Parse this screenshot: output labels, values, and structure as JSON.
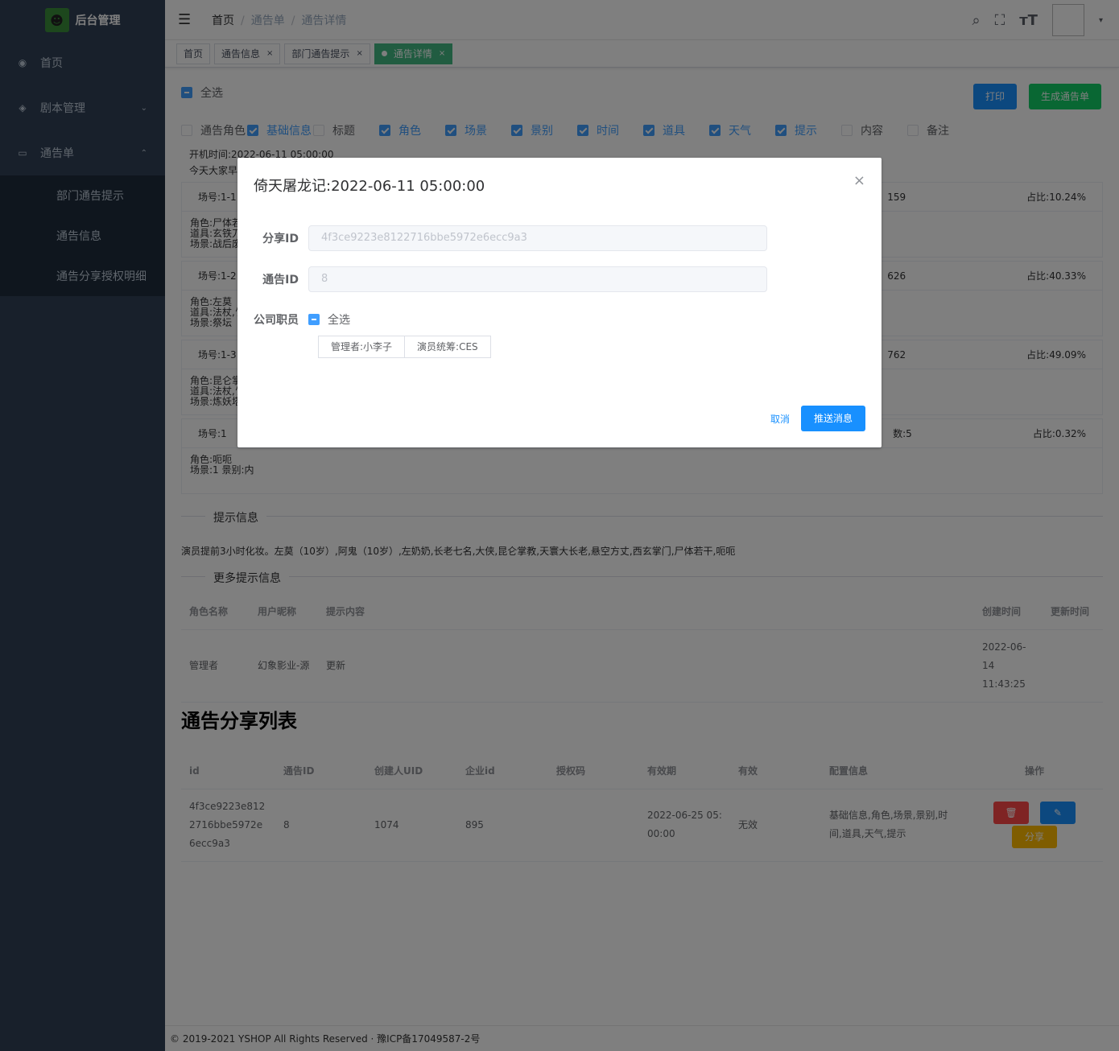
{
  "sidebar": {
    "logo_text": "后台管理",
    "items": [
      {
        "label": "首页",
        "icon": "dashboard-icon"
      },
      {
        "label": "剧本管理",
        "icon": "cube-icon",
        "arrow": "⌄"
      },
      {
        "label": "通告单",
        "icon": "calendar-icon",
        "arrow": "⌃"
      }
    ],
    "sub_items": [
      "部门通告提示",
      "通告信息",
      "通告分享授权明细"
    ]
  },
  "navbar": {
    "breadcrumb": [
      "首页",
      "通告单",
      "通告详情"
    ],
    "sep": "/",
    "avatar_caret": "▾"
  },
  "tags": [
    {
      "label": "首页"
    },
    {
      "label": "通告信息",
      "close": "×"
    },
    {
      "label": "部门通告提示",
      "close": "×"
    },
    {
      "label": "通告详情",
      "close": "×",
      "active": true
    }
  ],
  "toolbar": {
    "select_all": "全选",
    "print": "打印",
    "generate": "生成通告单",
    "print_color": "#1890ff",
    "generate_color": "#13ce66"
  },
  "fields": [
    {
      "label": "通告角色",
      "checked": false
    },
    {
      "label": "基础信息",
      "checked": true
    },
    {
      "label": "标题",
      "checked": false
    },
    {
      "label": "角色",
      "checked": true
    },
    {
      "label": "场景",
      "checked": true
    },
    {
      "label": "景别",
      "checked": true
    },
    {
      "label": "时间",
      "checked": true
    },
    {
      "label": "道具",
      "checked": true
    },
    {
      "label": "天气",
      "checked": true
    },
    {
      "label": "提示",
      "checked": true
    },
    {
      "label": "内容",
      "checked": false
    },
    {
      "label": "备注",
      "checked": false
    }
  ],
  "notice": {
    "open_time": "开机时间:2022-06-11 05:00:00",
    "greeting": "今天大家早"
  },
  "cards": [
    {
      "scene": "场号:1-1",
      "mid": "159",
      "ratio": "占比:10.24%",
      "lines": [
        "角色:尸体若",
        "道具:玄铁刀",
        "场景:战后废"
      ]
    },
    {
      "scene": "场号:1-2",
      "mid": "626",
      "ratio": "占比:40.33%",
      "lines": [
        "角色:左莫",
        "道具:法杖,饣",
        "场景:祭坛"
      ]
    },
    {
      "scene": "场号:1-3",
      "mid": "762",
      "ratio": "占比:49.09%",
      "lines": [
        "角色:昆仑掌",
        "道具:法杖,饣",
        "场景:炼妖塔"
      ]
    },
    {
      "scene": "场号:1",
      "mid": "数:5",
      "ratio": "占比:0.32%",
      "lines": [
        "角色:呃呃",
        "场景:1   景别:内"
      ]
    }
  ],
  "tips": {
    "title": "提示信息",
    "text": "演员提前3小时化妆。左莫（10岁）,阿鬼（10岁）,左奶奶,长老七名,大侠,昆仑掌教,天寰大长老,悬空方丈,西玄掌门,尸体若干,呃呃",
    "more_title": "更多提示信息"
  },
  "more_table": {
    "headers": [
      "角色名称",
      "用户昵称",
      "提示内容",
      "创建时间",
      "更新时间"
    ],
    "row": [
      "管理者",
      "幻象影业-源",
      "更新",
      "2022-06-14 11:43:25",
      ""
    ]
  },
  "share": {
    "title": "通告分享列表",
    "headers": [
      "id",
      "通告ID",
      "创建人UID",
      "企业id",
      "授权码",
      "有效期",
      "有效",
      "配置信息",
      "操作"
    ],
    "row": {
      "id": "4f3ce9223e8122716bbe5972e6ecc9a3",
      "notice_id": "8",
      "uid": "1074",
      "company": "895",
      "code": "",
      "expire": "2022-06-25 05:00:00",
      "valid": "无效",
      "config": "基础信息,角色,场景,景别,时间,道具,天气,提示",
      "share_label": "分享"
    }
  },
  "footer": "© 2019-2021 YSHOP All Rights Reserved · 豫ICP备17049587-2号",
  "dialog": {
    "title": "倚天屠龙记:2022-06-11 05:00:00",
    "close": "×",
    "share_id_label": "分享ID",
    "share_id": "4f3ce9223e8122716bbe5972e6ecc9a3",
    "notice_id_label": "通告ID",
    "notice_id": "8",
    "staff_label": "公司职员",
    "select_all": "全选",
    "staff": [
      "管理者:小李子",
      "演员统筹:CES"
    ],
    "cancel": "取消",
    "push": "推送消息"
  }
}
